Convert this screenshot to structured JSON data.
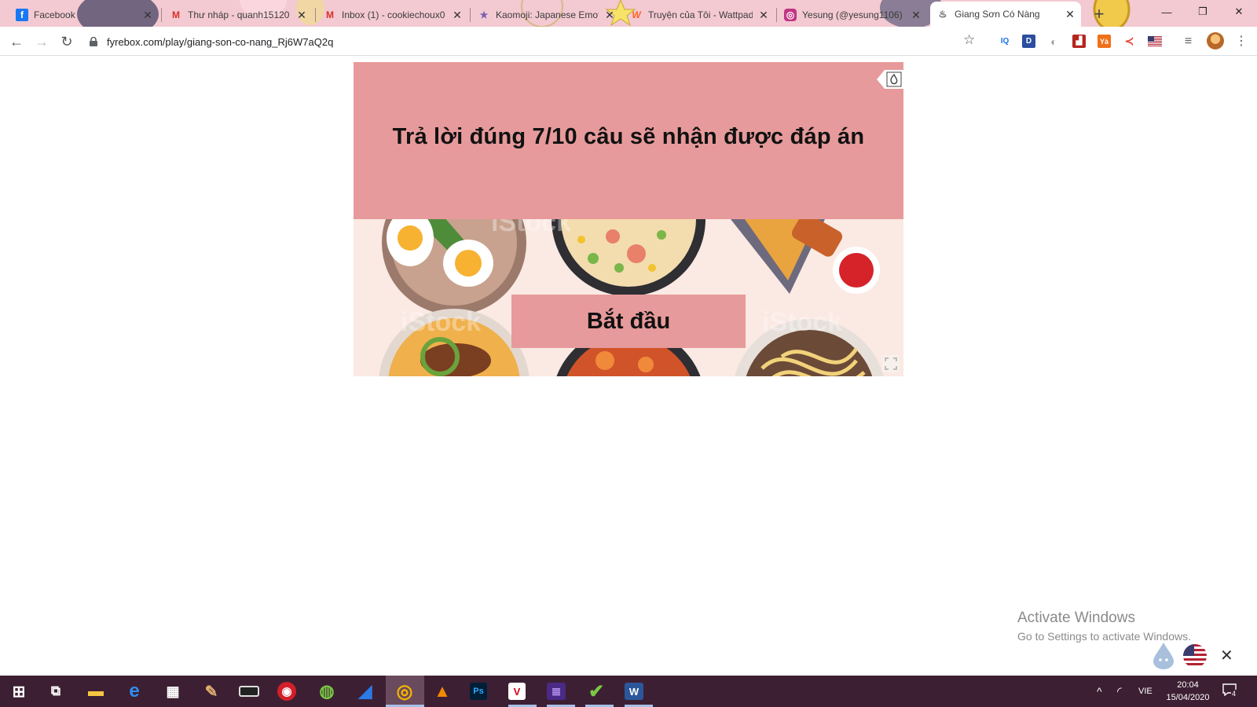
{
  "browser": {
    "tabs": [
      {
        "title": "Facebook",
        "icon": "facebook-icon",
        "icon_glyph": "f",
        "icon_color": "#1877f2"
      },
      {
        "title": "Thư nháp - quanh15120",
        "icon": "gmail-icon",
        "icon_glyph": "M",
        "icon_color": "#d93025"
      },
      {
        "title": "Inbox (1) - cookiechoux0",
        "icon": "gmail-icon",
        "icon_glyph": "M",
        "icon_color": "#d93025"
      },
      {
        "title": "Kaomoji: Japanese Emoti",
        "icon": "star-icon",
        "icon_glyph": "★",
        "icon_color": "#7a5fb0"
      },
      {
        "title": "Truyện của Tôi - Wattpad",
        "icon": "wattpad-icon",
        "icon_glyph": "W",
        "icon_color": "#ff6122"
      },
      {
        "title": "Yesung (@yesung1106)",
        "icon": "instagram-icon",
        "icon_glyph": "◎",
        "icon_color": "#c13584"
      },
      {
        "title": "Giang Sơn Có Nàng",
        "icon": "fyrebox-icon",
        "icon_glyph": "♨",
        "icon_color": "#555555",
        "active": true
      }
    ],
    "new_tab_label": "+",
    "window_controls": {
      "minimize": "—",
      "maximize": "❐",
      "close": "✕"
    },
    "nav": {
      "back": "←",
      "forward": "→",
      "reload": "↻"
    },
    "url": "fyrebox.com/play/giang-son-co-nang_Rj6W7aQ2q",
    "extensions": [
      {
        "name": "iq-extension-icon",
        "glyph": "IQ",
        "color": "#1a73e8",
        "bg": "transparent"
      },
      {
        "name": "d-extension-icon",
        "glyph": "D",
        "color": "#ffffff",
        "bg": "#2b4ea0"
      },
      {
        "name": "moon-extension-icon",
        "glyph": "◐",
        "color": "#9aa0a6",
        "bg": "transparent"
      },
      {
        "name": "chart-extension-icon",
        "glyph": "▟",
        "color": "#ffffff",
        "bg": "#b3261e"
      },
      {
        "name": "ya-extension-icon",
        "glyph": "Yà",
        "color": "#ffffff",
        "bg": "#f0701a"
      },
      {
        "name": "share-extension-icon",
        "glyph": "≺",
        "color": "#ea4335",
        "bg": "transparent"
      },
      {
        "name": "us-flag-extension-icon",
        "glyph": "",
        "color": "#b22234",
        "bg": "#3c3b6e"
      },
      {
        "name": "media-extension-icon",
        "glyph": "≡",
        "color": "#5f6368",
        "bg": "transparent"
      }
    ]
  },
  "game": {
    "banner_text": "Trả lời đúng 7/10 câu sẽ nhận được đáp án",
    "start_label": "Bắt đầu",
    "colors": {
      "banner": "#e79a9b",
      "button": "#e79a9b"
    }
  },
  "watermark": {
    "title": "Activate Windows",
    "subtitle": "Go to Settings to activate Windows."
  },
  "taskbar": {
    "apps": [
      {
        "name": "windows-start-icon",
        "glyph": "⊞",
        "color": "#ffffff",
        "bg": "transparent"
      },
      {
        "name": "task-view-icon",
        "glyph": "⧉",
        "color": "#ffffff",
        "bg": "transparent"
      },
      {
        "name": "file-explorer-icon",
        "glyph": "▬",
        "color": "#f4c542",
        "bg": "transparent"
      },
      {
        "name": "edge-icon",
        "glyph": "e",
        "color": "#2f8cf0",
        "bg": "transparent"
      },
      {
        "name": "store-icon",
        "glyph": "▦",
        "color": "#ffffff",
        "bg": "transparent"
      },
      {
        "name": "paint-tool-icon",
        "glyph": "✎",
        "color": "#e0b070",
        "bg": "transparent"
      },
      {
        "name": "media-bar-icon",
        "glyph": "▭",
        "color": "#ffffff",
        "bg": "#222222"
      },
      {
        "name": "screen-recorder-icon",
        "glyph": "◉",
        "color": "#ffffff",
        "bg": "#d21f2a"
      },
      {
        "name": "green-app-icon",
        "glyph": "◍",
        "color": "#7ac943",
        "bg": "transparent"
      },
      {
        "name": "shark-app-icon",
        "glyph": "◢",
        "color": "#2a7be4",
        "bg": "transparent"
      },
      {
        "name": "chrome-icon",
        "glyph": "◎",
        "color": "#f4b400",
        "bg": "transparent"
      },
      {
        "name": "vlc-icon",
        "glyph": "▲",
        "color": "#f08a00",
        "bg": "transparent"
      },
      {
        "name": "photoshop-icon",
        "glyph": "Ps",
        "color": "#31a8ff",
        "bg": "#001e36"
      },
      {
        "name": "unikey-icon",
        "glyph": "V",
        "color": "#d0021b",
        "bg": "#ffffff"
      },
      {
        "name": "winrar-icon",
        "glyph": "≣",
        "color": "#c8a4ff",
        "bg": "#4b2a86"
      },
      {
        "name": "checkmark-app-icon",
        "glyph": "✔",
        "color": "#7ac943",
        "bg": "transparent"
      },
      {
        "name": "word-icon",
        "glyph": "W",
        "color": "#ffffff",
        "bg": "#2b579a"
      }
    ],
    "tray": {
      "chevron": "^",
      "wifi": "◜",
      "language": "VIE"
    },
    "clock": {
      "time": "20:04",
      "date": "15/04/2020"
    },
    "notifications": {
      "count": "4"
    }
  }
}
